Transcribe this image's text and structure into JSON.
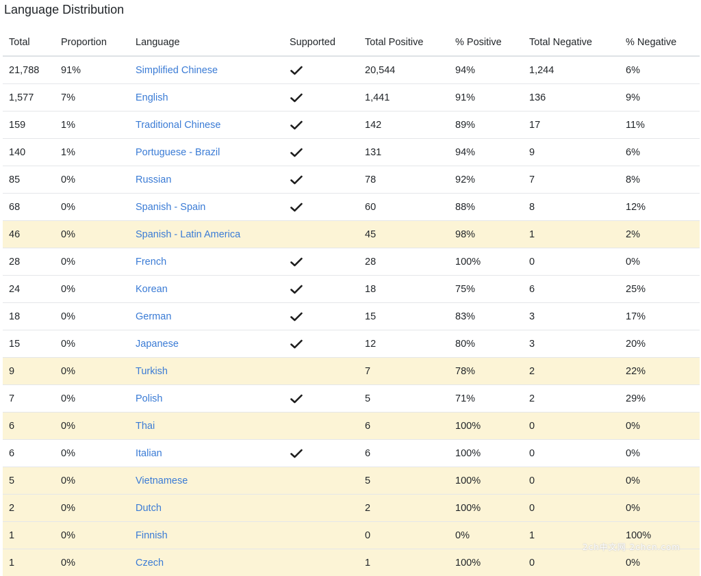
{
  "title": "Language Distribution",
  "columns": {
    "total": "Total",
    "proportion": "Proportion",
    "language": "Language",
    "supported": "Supported",
    "total_positive": "Total Positive",
    "pct_positive": "% Positive",
    "total_negative": "Total Negative",
    "pct_negative": "% Negative"
  },
  "supported_icon": "checkmark-icon",
  "colors": {
    "link": "#3a7bd5",
    "unsupported_row_bg": "#fcf4d6"
  },
  "rows": [
    {
      "total": "21,788",
      "proportion": "91%",
      "language": "Simplified Chinese",
      "supported": true,
      "total_positive": "20,544",
      "pct_positive": "94%",
      "total_negative": "1,244",
      "pct_negative": "6%"
    },
    {
      "total": "1,577",
      "proportion": "7%",
      "language": "English",
      "supported": true,
      "total_positive": "1,441",
      "pct_positive": "91%",
      "total_negative": "136",
      "pct_negative": "9%"
    },
    {
      "total": "159",
      "proportion": "1%",
      "language": "Traditional Chinese",
      "supported": true,
      "total_positive": "142",
      "pct_positive": "89%",
      "total_negative": "17",
      "pct_negative": "11%"
    },
    {
      "total": "140",
      "proportion": "1%",
      "language": "Portuguese - Brazil",
      "supported": true,
      "total_positive": "131",
      "pct_positive": "94%",
      "total_negative": "9",
      "pct_negative": "6%"
    },
    {
      "total": "85",
      "proportion": "0%",
      "language": "Russian",
      "supported": true,
      "total_positive": "78",
      "pct_positive": "92%",
      "total_negative": "7",
      "pct_negative": "8%"
    },
    {
      "total": "68",
      "proportion": "0%",
      "language": "Spanish - Spain",
      "supported": true,
      "total_positive": "60",
      "pct_positive": "88%",
      "total_negative": "8",
      "pct_negative": "12%"
    },
    {
      "total": "46",
      "proportion": "0%",
      "language": "Spanish - Latin America",
      "supported": false,
      "total_positive": "45",
      "pct_positive": "98%",
      "total_negative": "1",
      "pct_negative": "2%"
    },
    {
      "total": "28",
      "proportion": "0%",
      "language": "French",
      "supported": true,
      "total_positive": "28",
      "pct_positive": "100%",
      "total_negative": "0",
      "pct_negative": "0%"
    },
    {
      "total": "24",
      "proportion": "0%",
      "language": "Korean",
      "supported": true,
      "total_positive": "18",
      "pct_positive": "75%",
      "total_negative": "6",
      "pct_negative": "25%"
    },
    {
      "total": "18",
      "proportion": "0%",
      "language": "German",
      "supported": true,
      "total_positive": "15",
      "pct_positive": "83%",
      "total_negative": "3",
      "pct_negative": "17%"
    },
    {
      "total": "15",
      "proportion": "0%",
      "language": "Japanese",
      "supported": true,
      "total_positive": "12",
      "pct_positive": "80%",
      "total_negative": "3",
      "pct_negative": "20%"
    },
    {
      "total": "9",
      "proportion": "0%",
      "language": "Turkish",
      "supported": false,
      "total_positive": "7",
      "pct_positive": "78%",
      "total_negative": "2",
      "pct_negative": "22%"
    },
    {
      "total": "7",
      "proportion": "0%",
      "language": "Polish",
      "supported": true,
      "total_positive": "5",
      "pct_positive": "71%",
      "total_negative": "2",
      "pct_negative": "29%"
    },
    {
      "total": "6",
      "proportion": "0%",
      "language": "Thai",
      "supported": false,
      "total_positive": "6",
      "pct_positive": "100%",
      "total_negative": "0",
      "pct_negative": "0%"
    },
    {
      "total": "6",
      "proportion": "0%",
      "language": "Italian",
      "supported": true,
      "total_positive": "6",
      "pct_positive": "100%",
      "total_negative": "0",
      "pct_negative": "0%"
    },
    {
      "total": "5",
      "proportion": "0%",
      "language": "Vietnamese",
      "supported": false,
      "total_positive": "5",
      "pct_positive": "100%",
      "total_negative": "0",
      "pct_negative": "0%"
    },
    {
      "total": "2",
      "proportion": "0%",
      "language": "Dutch",
      "supported": false,
      "total_positive": "2",
      "pct_positive": "100%",
      "total_negative": "0",
      "pct_negative": "0%"
    },
    {
      "total": "1",
      "proportion": "0%",
      "language": "Finnish",
      "supported": false,
      "total_positive": "0",
      "pct_positive": "0%",
      "total_negative": "1",
      "pct_negative": "100%"
    },
    {
      "total": "1",
      "proportion": "0%",
      "language": "Czech",
      "supported": false,
      "total_positive": "1",
      "pct_positive": "100%",
      "total_negative": "0",
      "pct_negative": "0%"
    }
  ],
  "watermark": "2ch中文网 2chcn.com"
}
